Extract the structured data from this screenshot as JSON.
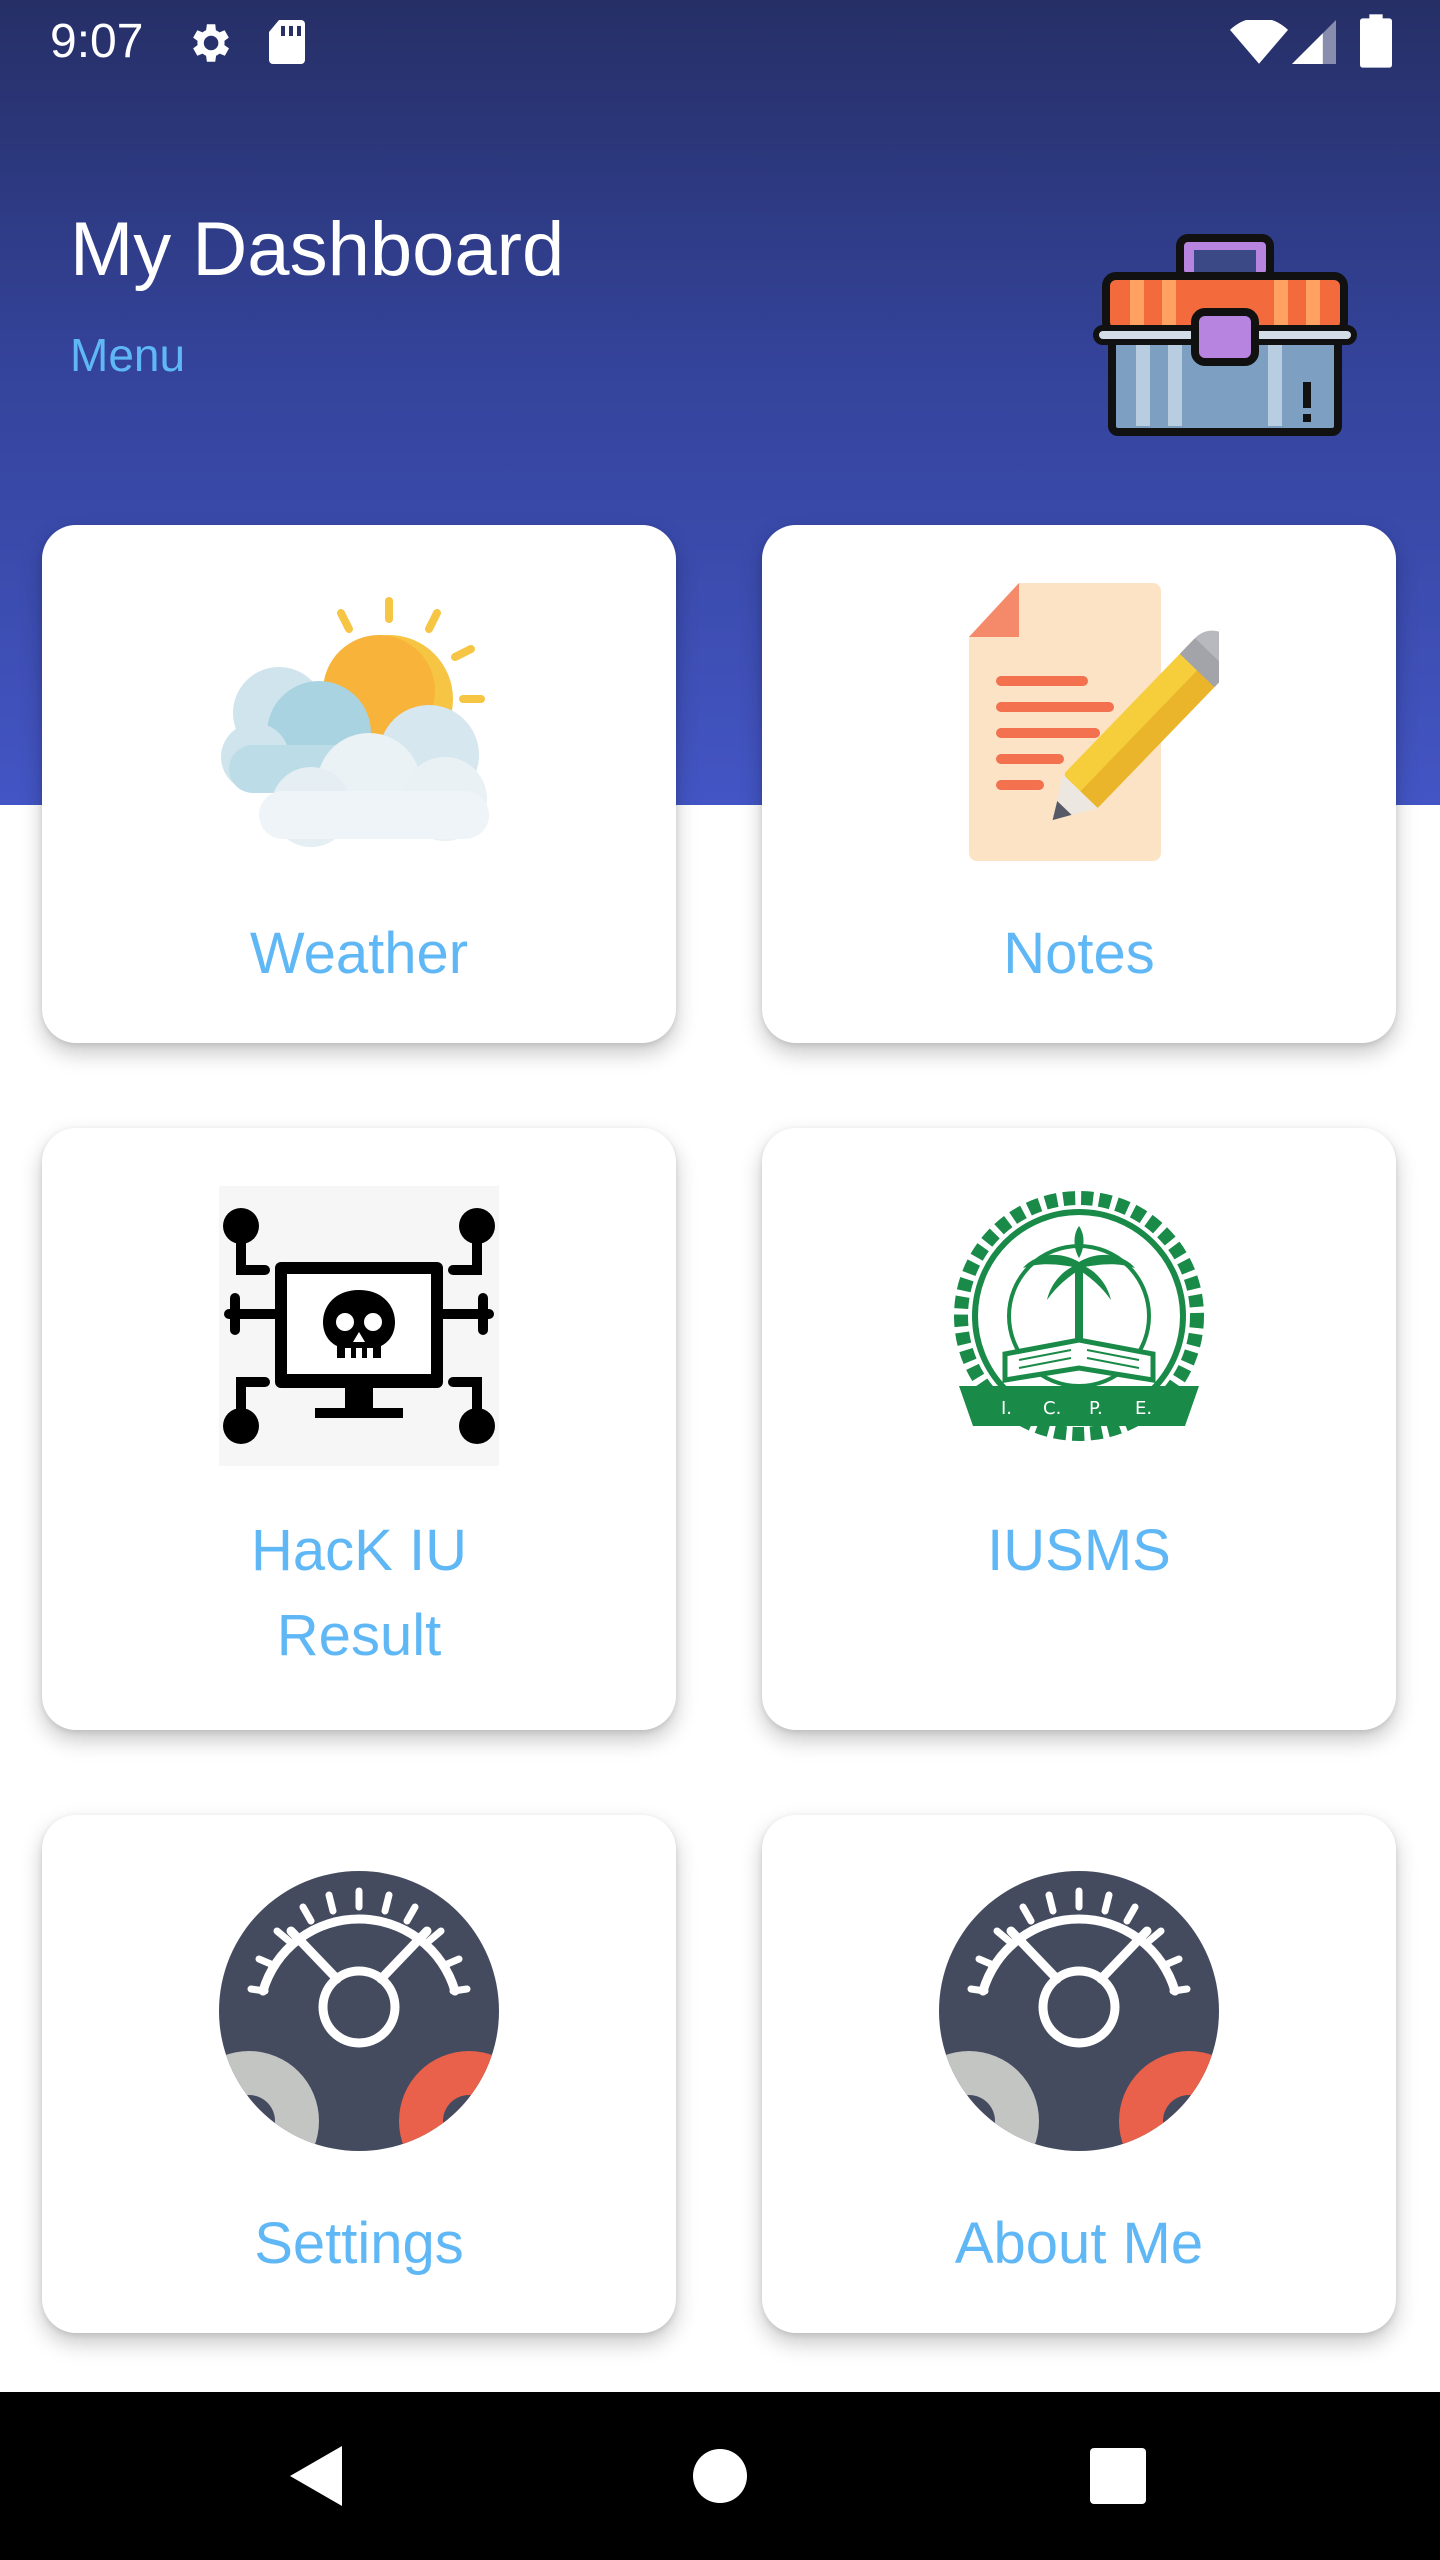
{
  "status_bar": {
    "time": "9:07",
    "icons": [
      "settings-icon",
      "sd-card-icon",
      "wifi-icon",
      "cell-signal-icon",
      "battery-icon"
    ]
  },
  "header": {
    "title": "My Dashboard",
    "menu_label": "Menu",
    "icon": "toolbox-icon"
  },
  "cards": [
    {
      "label": "Weather",
      "icon": "weather-icon"
    },
    {
      "label": "Notes",
      "icon": "notes-icon"
    },
    {
      "label_line1": "HacK IU",
      "label_line2": "Result",
      "icon": "hacker-computer-icon"
    },
    {
      "label": "IUSMS",
      "icon": "university-logo-icon"
    },
    {
      "label": "Settings",
      "icon": "gears-icon"
    },
    {
      "label": "About Me",
      "icon": "gears-icon"
    }
  ],
  "nav_bar": {
    "buttons": [
      "back-icon",
      "home-icon",
      "recents-icon"
    ]
  },
  "colors": {
    "header_top": "#262f66",
    "header_bottom": "#4355c4",
    "accent_text": "#5fb8f5",
    "card_background": "#ffffff",
    "nav_background": "#000000"
  }
}
